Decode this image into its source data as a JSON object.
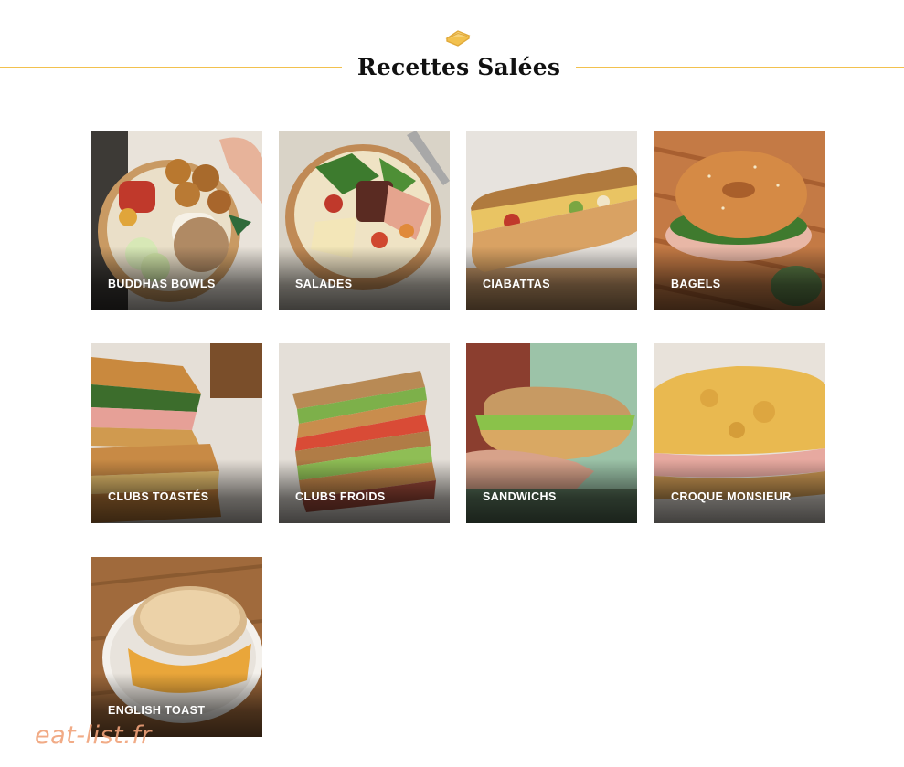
{
  "header": {
    "title": "Recettes Salées",
    "icon": "sandwich-icon",
    "accent_color": "#f2c14e"
  },
  "categories": [
    {
      "label": "BUDDHAS BOWLS"
    },
    {
      "label": "SALADES"
    },
    {
      "label": "CIABATTAS"
    },
    {
      "label": "BAGELS"
    },
    {
      "label": "CLUBS TOASTÉS"
    },
    {
      "label": "CLUBS FROIDS"
    },
    {
      "label": "SANDWICHS"
    },
    {
      "label": "CROQUE MONSIEUR"
    },
    {
      "label": "ENGLISH TOAST"
    }
  ],
  "watermark": {
    "text": "eat-list.fr",
    "color": "#f0a27a"
  }
}
